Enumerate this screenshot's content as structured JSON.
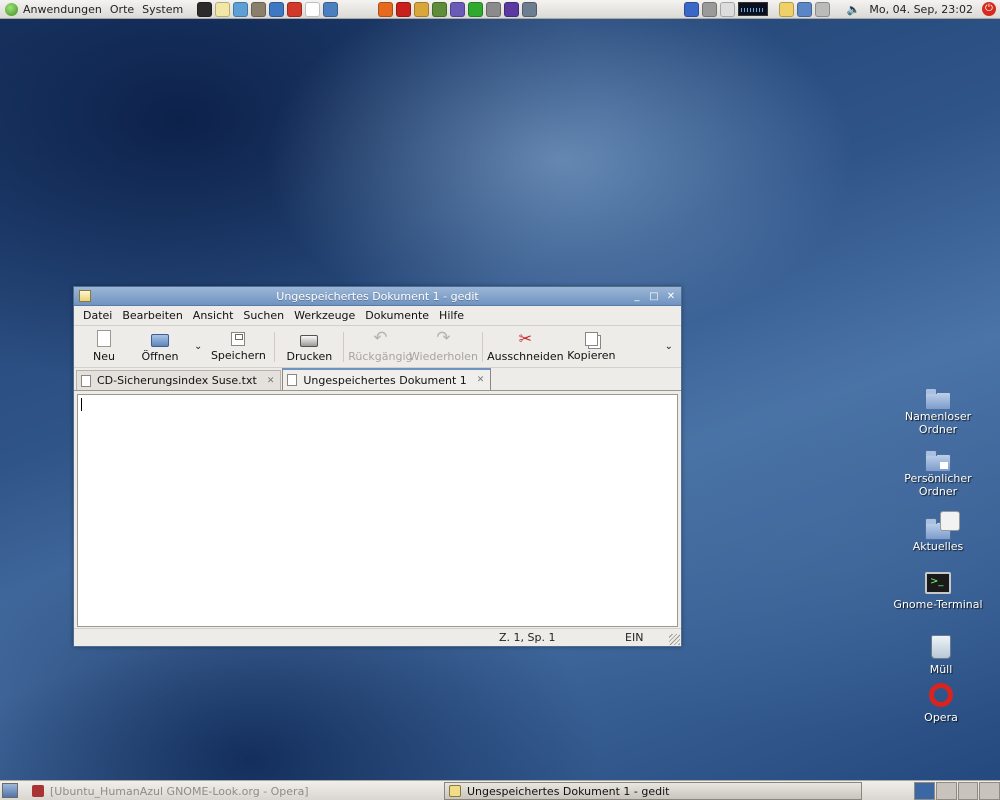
{
  "top_panel": {
    "menus": [
      "Anwendungen",
      "Orte",
      "System"
    ],
    "launchers": [
      {
        "icon": "terminal-icon",
        "color": "#2b2b2b"
      },
      {
        "icon": "text-editor-icon",
        "color": "#f3e7a6"
      },
      {
        "icon": "draw-icon",
        "color": "#5da0d6"
      },
      {
        "icon": "gimp-icon",
        "color": "#8a7f6a"
      },
      {
        "icon": "browser-icon",
        "color": "#3f78c2"
      },
      {
        "icon": "pdf-icon",
        "color": "#d13a2a"
      },
      {
        "icon": "document-icon",
        "color": "#ffffff"
      },
      {
        "icon": "network-icon",
        "color": "#4a7fc0"
      }
    ],
    "launchers2": [
      {
        "icon": "firefox-icon",
        "color": "#e66a1d"
      },
      {
        "icon": "opera-icon",
        "color": "#c8201c"
      },
      {
        "icon": "gaim-icon",
        "color": "#d9a63b"
      },
      {
        "icon": "gnucash-icon",
        "color": "#5d8c3a"
      },
      {
        "icon": "rss-icon",
        "color": "#6a5bb8"
      },
      {
        "icon": "seti-icon",
        "color": "#2faa2f"
      },
      {
        "icon": "books-icon",
        "color": "#8b8b8b"
      },
      {
        "icon": "inkscape-icon",
        "color": "#5a39a0"
      },
      {
        "icon": "archive-icon",
        "color": "#6c7d8f"
      }
    ],
    "tray": [
      {
        "icon": "notes-icon",
        "color": "#3b67c7"
      },
      {
        "icon": "drive-icon",
        "color": "#9a9a9a"
      },
      {
        "icon": "monitor-icon",
        "color": "#dddddd"
      },
      {
        "icon": "battery-icon",
        "color": "#f0d068"
      },
      {
        "icon": "search-globe-icon",
        "color": "#5b86c6"
      },
      {
        "icon": "network-tray-icon",
        "color": "#bbbbbb"
      }
    ],
    "volume_glyph": "🔈",
    "clock": "Mo, 04. Sep, 23:02"
  },
  "window": {
    "title": "Ungespeichertes Dokument 1 - gedit",
    "controls": {
      "minimize": "_",
      "maximize": "□",
      "close": "✕"
    },
    "menu": [
      "Datei",
      "Bearbeiten",
      "Ansicht",
      "Suchen",
      "Werkzeuge",
      "Dokumente",
      "Hilfe"
    ],
    "toolbar": {
      "new": "Neu",
      "open": "Öffnen",
      "save": "Speichern",
      "print": "Drucken",
      "undo": "Rückgängig",
      "redo": "Wiederholen",
      "cut": "Ausschneiden",
      "copy": "Kopieren",
      "dropdown_glyph": "⌄",
      "overflow_glyph": "⌄"
    },
    "tabs": [
      {
        "label": "CD-Sicherungsindex Suse.txt",
        "active": false
      },
      {
        "label": "Ungespeichertes Dokument 1",
        "active": true
      }
    ],
    "tab_close_glyph": "✕",
    "status": {
      "position": "Z. 1, Sp. 1",
      "mode": "EIN"
    }
  },
  "desktop_icons": [
    {
      "label_line1": "Namenloser",
      "label_line2": "Ordner"
    },
    {
      "label_line1": "Persönlicher",
      "label_line2": "Ordner"
    },
    {
      "label_line1": "Aktuelles",
      "label_line2": ""
    },
    {
      "label_line1": "Gnome-Terminal",
      "label_line2": ""
    },
    {
      "label_line1": "Müll",
      "label_line2": ""
    },
    {
      "label_line1": "Opera",
      "label_line2": ""
    }
  ],
  "terminal_prompt": ">_",
  "bottom_panel": {
    "tasks": [
      {
        "label": "[Ubuntu_HumanAzul GNOME-Look.org - Opera]",
        "active": false
      },
      {
        "label": "Ungespeichertes Dokument 1 - gedit",
        "active": true
      }
    ],
    "workspaces": 4,
    "current_workspace": 1
  }
}
